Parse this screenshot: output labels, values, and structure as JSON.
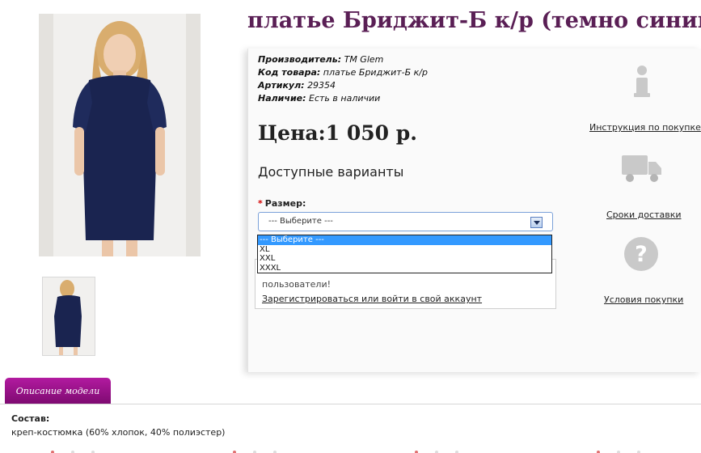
{
  "product": {
    "title": "платье Бриджит-Б к/р (темно синий)",
    "manufacturer_label": "Производитель:",
    "manufacturer_value": "TM Glem",
    "code_label": "Код товара:",
    "code_value": "платье Бриджит-Б к/р",
    "sku_label": "Артикул:",
    "sku_value": "29354",
    "stock_label": "Наличие:",
    "stock_value": "Есть в наличии",
    "price": "Цена:1 050 р."
  },
  "options": {
    "heading": "Доступные варианты",
    "size_label": "Размер:",
    "selected": "--- Выберите ---",
    "list": [
      "--- Выберите ---",
      "XL",
      "XXL",
      "XXXL"
    ]
  },
  "login": {
    "text": "пользователи!",
    "link": "Зарегистрироваться или войти в свой аккаунт"
  },
  "sidebar": {
    "instructions": "Инструкция по покупке",
    "delivery": "Сроки доставки",
    "terms": "Условия покупки"
  },
  "tabs": {
    "description": "Описание модели"
  },
  "description": {
    "composition_title": "Состав:",
    "composition_text": "креп-костюмка (60% хлопок, 40% полиэстер)"
  },
  "colors": {
    "title": "#5a1f55",
    "tab": "#9a1289",
    "dress": "#1a2450",
    "icon_gray": "#c9c9c9",
    "selected_option": "#3399ff"
  },
  "icons": [
    "info-icon",
    "truck-icon",
    "question-icon",
    "dropdown-arrow-icon"
  ]
}
